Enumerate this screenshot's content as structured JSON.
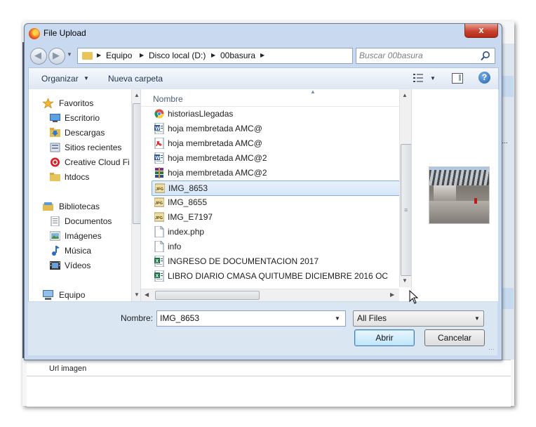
{
  "dialog": {
    "title": "File Upload",
    "close_label": "x"
  },
  "address": {
    "crumbs": [
      "Equipo",
      "Disco local (D:)",
      "00basura"
    ]
  },
  "search": {
    "placeholder": "Buscar 00basura"
  },
  "toolbar": {
    "organize_label": "Organizar",
    "new_folder_label": "Nueva carpeta",
    "help_label": "?"
  },
  "sidebar": {
    "favorites_label": "Favoritos",
    "favorites": [
      "Escritorio",
      "Descargas",
      "Sitios recientes",
      "Creative Cloud Fi",
      "htdocs"
    ],
    "libraries_label": "Bibliotecas",
    "libraries": [
      "Documentos",
      "Imágenes",
      "Música",
      "Vídeos"
    ],
    "computer_label": "Equipo"
  },
  "files": {
    "column_name": "Nombre",
    "items": [
      {
        "name": "historiasLlegadas",
        "icon": "chrome-icon"
      },
      {
        "name": "hoja membretada AMC@",
        "icon": "word-doc-icon"
      },
      {
        "name": "hoja membretada AMC@",
        "icon": "pdf-icon"
      },
      {
        "name": "hoja membretada AMC@2",
        "icon": "word-doc-icon"
      },
      {
        "name": "hoja membretada AMC@2",
        "icon": "rar-archive-icon"
      },
      {
        "name": "IMG_8653",
        "icon": "jpg-icon",
        "selected": true
      },
      {
        "name": "IMG_8655",
        "icon": "jpg-icon"
      },
      {
        "name": "IMG_E7197",
        "icon": "jpg-icon"
      },
      {
        "name": "index.php",
        "icon": "blank-file-icon"
      },
      {
        "name": "info",
        "icon": "blank-file-icon"
      },
      {
        "name": "INGRESO DE DOCUMENTACION 2017",
        "icon": "excel-icon"
      },
      {
        "name": "LIBRO DIARIO CMASA QUITUMBE DICIEMBRE 2016  OC",
        "icon": "excel-icon"
      }
    ]
  },
  "bottom": {
    "filename_label": "Nombre:",
    "filename_value": "IMG_8653",
    "filetype_value": "All Files",
    "open_label": "Abrir",
    "cancel_label": "Cancelar"
  },
  "background": {
    "url_label": "Url imagen",
    "right_text": "ji..."
  },
  "colors": {
    "selection": "#d5e6fa",
    "dialog_frame": "#c9daf0",
    "close_button": "#c8432f"
  }
}
